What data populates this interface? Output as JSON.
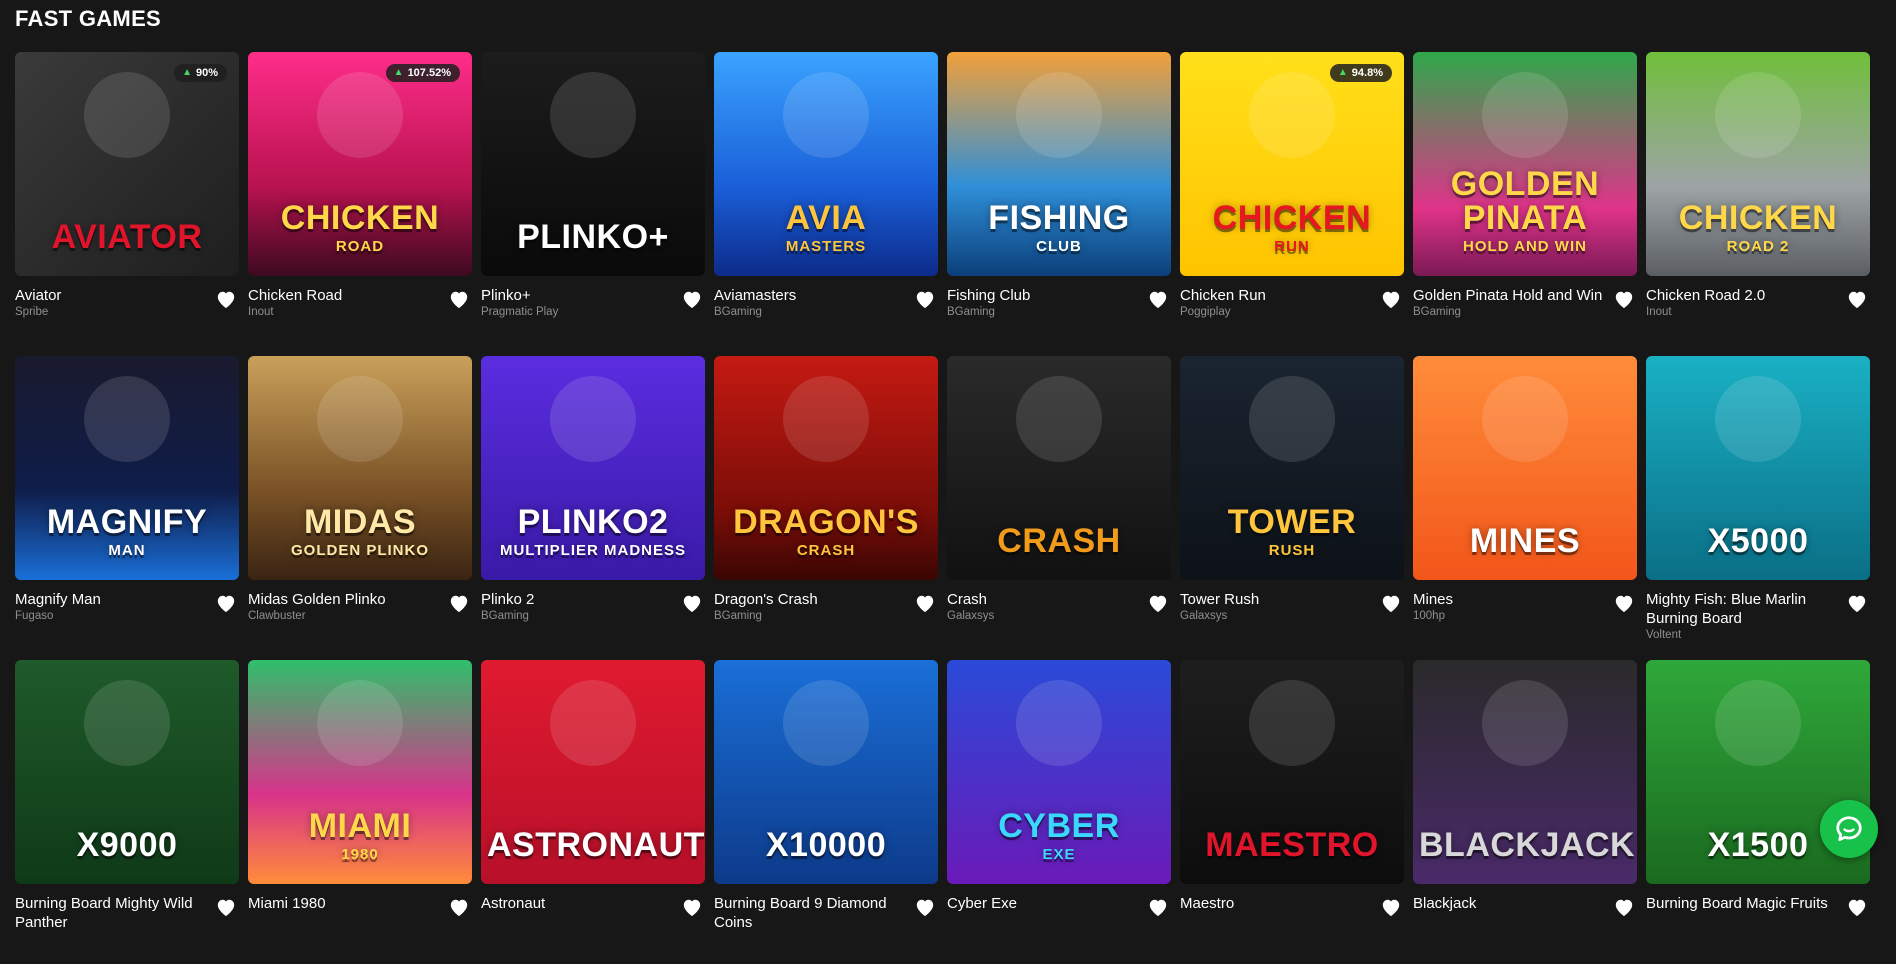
{
  "section": {
    "title": "FAST GAMES"
  },
  "games": [
    {
      "name": "Aviator",
      "provider": "Spribe",
      "thumb_text": "Aviator",
      "thumb_sub": "",
      "rtp": "90%",
      "bg": "linear-gradient(135deg,#3a3a3a,#1e1e1e)",
      "text_color": "#e0142a",
      "icon": "plane-icon"
    },
    {
      "name": "Chicken Road",
      "provider": "Inout",
      "thumb_text": "CHICKEN",
      "thumb_sub": "ROAD",
      "rtp": "107.52%",
      "bg": "linear-gradient(180deg,#ff2d8a,#b8124f 60%,#3d0a1f)",
      "text_color": "#ffd84a",
      "icon": "chicken-icon"
    },
    {
      "name": "Plinko+",
      "provider": "Pragmatic Play",
      "thumb_text": "PLiNKO+",
      "thumb_sub": "",
      "rtp": "",
      "bg": "linear-gradient(180deg,#1c1c1c,#0a0a0a)",
      "text_color": "#ffffff",
      "icon": "ball-icon"
    },
    {
      "name": "Aviamasters",
      "provider": "BGaming",
      "thumb_text": "AVIA",
      "thumb_sub": "MASTERS",
      "rtp": "",
      "bg": "linear-gradient(180deg,#3aa3ff,#1a5fd8 60%,#0d2b8a)",
      "text_color": "#ffc53d",
      "icon": "plane-icon"
    },
    {
      "name": "Fishing Club",
      "provider": "BGaming",
      "thumb_text": "FISHING",
      "thumb_sub": "CLUB",
      "rtp": "",
      "bg": "linear-gradient(180deg,#f2a03a,#2f8fd8 60%,#0b3f7a)",
      "text_color": "#ffffff",
      "icon": "fish-icon"
    },
    {
      "name": "Chicken Run",
      "provider": "Poggiplay",
      "thumb_text": "CHICKEN",
      "thumb_sub": "RUN",
      "rtp": "94.8%",
      "bg": "linear-gradient(180deg,#ffe01a,#ffc400)",
      "text_color": "#e8161f",
      "icon": "chicken-icon"
    },
    {
      "name": "Golden Pinata Hold and Win",
      "provider": "BGaming",
      "thumb_text": "GOLDEN PINATA",
      "thumb_sub": "HOLD AND WIN",
      "rtp": "",
      "bg": "linear-gradient(180deg,#2fa84a,#e0338a 70%,#7a1a55)",
      "text_color": "#ffd84a",
      "icon": "pinata-icon"
    },
    {
      "name": "Chicken Road 2.0",
      "provider": "Inout",
      "thumb_text": "CHICKEN",
      "thumb_sub": "ROAD 2",
      "rtp": "",
      "bg": "linear-gradient(180deg,#6fbf3a,#9ea3a6 60%,#5b5f63)",
      "text_color": "#ffd84a",
      "icon": "chicken-icon"
    },
    {
      "name": "Magnify Man",
      "provider": "Fugaso",
      "thumb_text": "MAGNIFY",
      "thumb_sub": "MAN",
      "rtp": "",
      "bg": "linear-gradient(180deg,#1a1a2e,#0f1d4a 60%,#1a6fd8)",
      "text_color": "#ffffff",
      "icon": "hero-icon"
    },
    {
      "name": "Midas Golden Plinko",
      "provider": "Clawbuster",
      "thumb_text": "MIDAS",
      "thumb_sub": "GOLDEN PLINKO",
      "rtp": "",
      "bg": "linear-gradient(180deg,#c9a05a,#7a5226 60%,#3a2412)",
      "text_color": "#ffe9a8",
      "icon": "king-icon"
    },
    {
      "name": "Plinko 2",
      "provider": "BGaming",
      "thumb_text": "PLINKO2",
      "thumb_sub": "MULTIPLIER MADNESS",
      "rtp": "",
      "bg": "linear-gradient(180deg,#5b2de0,#3a1aa8)",
      "text_color": "#ffffff",
      "icon": "ball-icon"
    },
    {
      "name": "Dragon's Crash",
      "provider": "BGaming",
      "thumb_text": "DRAGON'S",
      "thumb_sub": "CRASH",
      "rtp": "",
      "bg": "linear-gradient(180deg,#c41a12,#7a0d08 70%,#3a0603)",
      "text_color": "#ffc53d",
      "icon": "dragon-icon"
    },
    {
      "name": "Crash",
      "provider": "Galaxsys",
      "thumb_text": "CRASH",
      "thumb_sub": "",
      "rtp": "",
      "bg": "linear-gradient(180deg,#2a2a2a,#111111)",
      "text_color": "#f29a1a",
      "icon": "bomb-icon"
    },
    {
      "name": "Tower Rush",
      "provider": "Galaxsys",
      "thumb_text": "TOWER",
      "thumb_sub": "RUSH",
      "rtp": "",
      "bg": "linear-gradient(180deg,#1a2430,#0d1218)",
      "text_color": "#ffc53d",
      "icon": "hook-icon"
    },
    {
      "name": "Mines",
      "provider": "100hp",
      "thumb_text": "MINES",
      "thumb_sub": "",
      "rtp": "",
      "bg": "linear-gradient(180deg,#ff8c3a,#f2561a)",
      "text_color": "#ffffff",
      "icon": "bomb-icon"
    },
    {
      "name": "Mighty Fish: Blue Marlin Burning Board",
      "provider": "Voltent",
      "thumb_text": "x5000",
      "thumb_sub": "",
      "rtp": "",
      "bg": "linear-gradient(180deg,#1ab0c4,#0a6f86)",
      "text_color": "#ffffff",
      "icon": "fish-icon"
    },
    {
      "name": "Burning Board Mighty Wild Panther",
      "provider": "",
      "thumb_text": "x9000",
      "thumb_sub": "",
      "rtp": "",
      "bg": "linear-gradient(180deg,#1f5a2a,#0f3a18)",
      "text_color": "#ffffff",
      "icon": "panther-icon"
    },
    {
      "name": "Miami 1980",
      "provider": "",
      "thumb_text": "MIAMI",
      "thumb_sub": "1980",
      "rtp": "",
      "bg": "linear-gradient(180deg,#2fbf6a,#d8338a 60%,#ff8c3a)",
      "text_color": "#ffd84a",
      "icon": "hero-icon"
    },
    {
      "name": "Astronaut",
      "provider": "",
      "thumb_text": "Astronaut",
      "thumb_sub": "",
      "rtp": "",
      "bg": "linear-gradient(180deg,#e01a2f,#b8102a)",
      "text_color": "#ffffff",
      "icon": "rocket-icon"
    },
    {
      "name": "Burning Board 9 Diamond Coins",
      "provider": "",
      "thumb_text": "x10000",
      "thumb_sub": "",
      "rtp": "",
      "bg": "linear-gradient(180deg,#1a6fd8,#0d3a8a)",
      "text_color": "#ffffff",
      "icon": "coin-icon"
    },
    {
      "name": "Cyber Exe",
      "provider": "",
      "thumb_text": "CYBER",
      "thumb_sub": "EXE",
      "rtp": "",
      "bg": "linear-gradient(180deg,#2a4ad8,#6a1ab8)",
      "text_color": "#3ad8ff",
      "icon": "robot-icon"
    },
    {
      "name": "Maestro",
      "provider": "",
      "thumb_text": "Maestro",
      "thumb_sub": "",
      "rtp": "",
      "bg": "linear-gradient(180deg,#1e1e1e,#0d0d0d)",
      "text_color": "#e0142a",
      "icon": "parrot-icon"
    },
    {
      "name": "Blackjack",
      "provider": "",
      "thumb_text": "BLACKJACK",
      "thumb_sub": "",
      "rtp": "",
      "bg": "linear-gradient(180deg,#2a2a2a,#4a2a6a)",
      "text_color": "#d8d8d8",
      "icon": "cards-icon"
    },
    {
      "name": "Burning Board Magic Fruits",
      "provider": "",
      "thumb_text": "x1500",
      "thumb_sub": "",
      "rtp": "",
      "bg": "linear-gradient(180deg,#2fa83a,#1a6a1f)",
      "text_color": "#ffffff",
      "icon": "fruit-icon"
    }
  ],
  "colors": {
    "background": "#171717",
    "rtp_arrow": "#47d66b",
    "chat": "#18c24a",
    "provider_text": "#8f8f8f"
  }
}
